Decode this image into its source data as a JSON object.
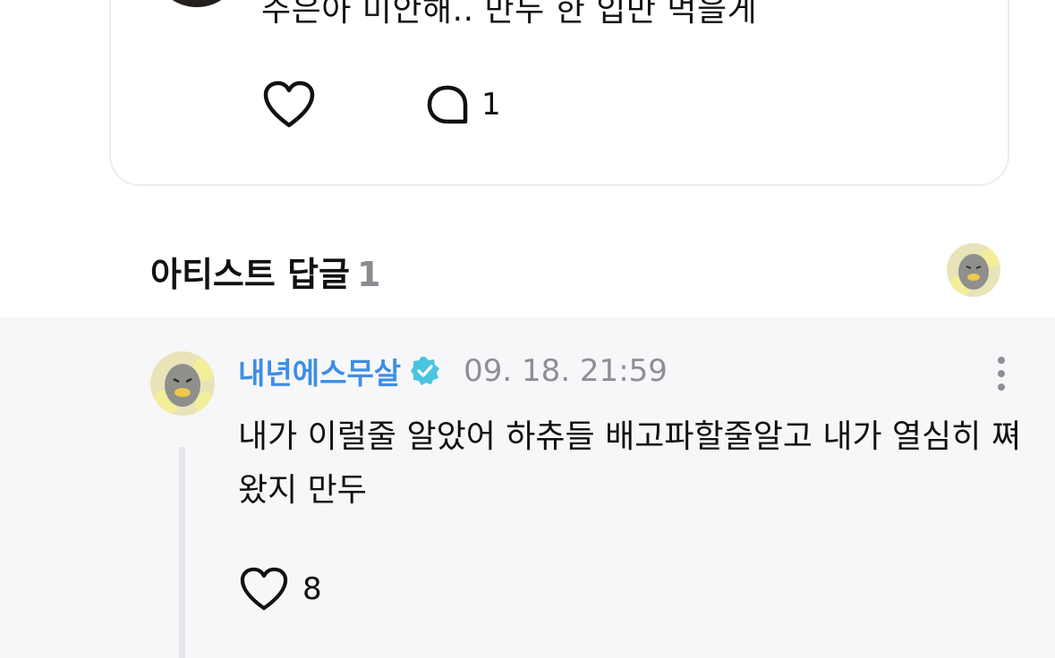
{
  "post": {
    "text": "주은아 미안해.. 만두 한 입만 먹을게",
    "like_icon": "heart-outline-icon",
    "comment_icon": "speech-bubble-icon",
    "comment_count": "1"
  },
  "artist_replies": {
    "title": "아티스트 답글",
    "count": "1"
  },
  "reply": {
    "author": "내년에스무살",
    "verified_icon": "verified-badge-icon",
    "timestamp": "09. 18. 21:59",
    "text": "내가 이럴줄 알았어 하츄들 배고파할줄알고 내가 열심히 쪄왔지 만두",
    "like_count": "8"
  },
  "colors": {
    "author": "#3d8ee6",
    "verified_badge": "#4cc3e0",
    "reply_background": "#f7f7f9",
    "muted_text": "#8e8e95"
  }
}
